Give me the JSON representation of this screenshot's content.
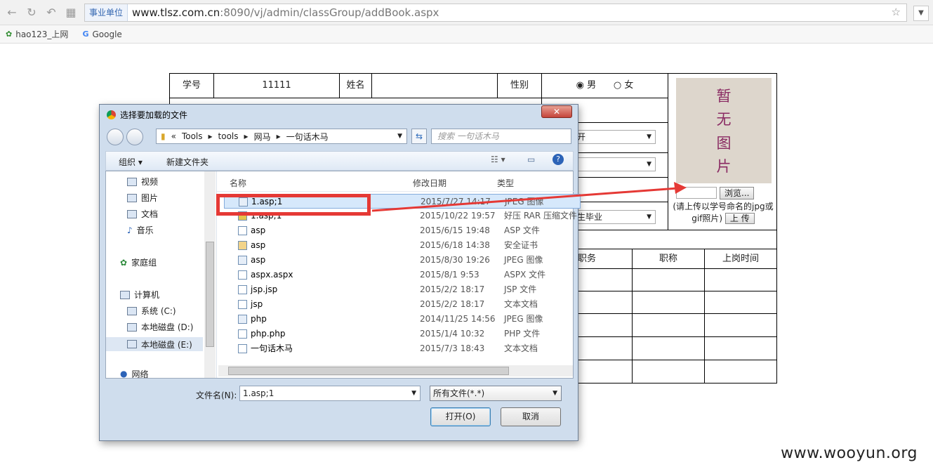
{
  "browser": {
    "site_tag": "事业单位",
    "url_host": "www.tlsz.com.cn",
    "url_path": ":8090/vj/admin/classGroup/addBook.aspx",
    "bookmarks": [
      "hao123_上网",
      "Google"
    ]
  },
  "form": {
    "labels": {
      "student_no": "学号",
      "name": "姓名",
      "gender": "性别"
    },
    "student_no_value": "11111",
    "gender_options": [
      "男",
      "女"
    ],
    "graduate_select": "生毕业",
    "select_partial": "开",
    "photo_placeholder": [
      "暂",
      "无",
      "图",
      "片"
    ],
    "browse_label": "浏览...",
    "upload_hint": "(请上传以学号命名的jpg或gif照片)",
    "upload_label": "上 传",
    "work_headers": [
      "职务",
      "职称",
      "上岗时间"
    ]
  },
  "dialog": {
    "title": "选择要加载的文件",
    "close_label": "✕",
    "breadcrumb": [
      "«",
      "Tools",
      "tools",
      "网马",
      "一句话木马"
    ],
    "search_placeholder": "搜索 一句话木马",
    "organize": "组织 ▾",
    "new_folder": "新建文件夹",
    "nav": [
      "视频",
      "图片",
      "文档",
      "音乐",
      "家庭组",
      "计算机",
      "系统 (C:)",
      "本地磁盘 (D:)",
      "本地磁盘 (E:)",
      "网络"
    ],
    "columns": {
      "name": "名称",
      "date": "修改日期",
      "type": "类型"
    },
    "files": [
      {
        "name": "1.asp;1",
        "date": "2015/7/27 14:17",
        "type": "JPEG 图像"
      },
      {
        "name": "1.asp;1",
        "date": "2015/10/22 19:57",
        "type": "好压 RAR 压缩文件"
      },
      {
        "name": "asp",
        "date": "2015/6/15 19:48",
        "type": "ASP 文件"
      },
      {
        "name": "asp",
        "date": "2015/6/18 14:38",
        "type": "安全证书"
      },
      {
        "name": "asp",
        "date": "2015/8/30 19:26",
        "type": "JPEG 图像"
      },
      {
        "name": "aspx.aspx",
        "date": "2015/8/1 9:53",
        "type": "ASPX 文件"
      },
      {
        "name": "jsp.jsp",
        "date": "2015/2/2 18:17",
        "type": "JSP 文件"
      },
      {
        "name": "jsp",
        "date": "2015/2/2 18:17",
        "type": "文本文档"
      },
      {
        "name": "php",
        "date": "2014/11/25 14:56",
        "type": "JPEG 图像"
      },
      {
        "name": "php.php",
        "date": "2015/1/4 10:32",
        "type": "PHP 文件"
      },
      {
        "name": "一句话木马",
        "date": "2015/7/3 18:43",
        "type": "文本文档"
      }
    ],
    "filename_label": "文件名(N):",
    "filename_value": "1.asp;1",
    "filetype_value": "所有文件(*.*)",
    "open_label": "打开(O)",
    "cancel_label": "取消"
  },
  "watermark": "www.wooyun.org",
  "colors": {
    "highlight_box": "#e53935",
    "arrow": "#e53935"
  }
}
